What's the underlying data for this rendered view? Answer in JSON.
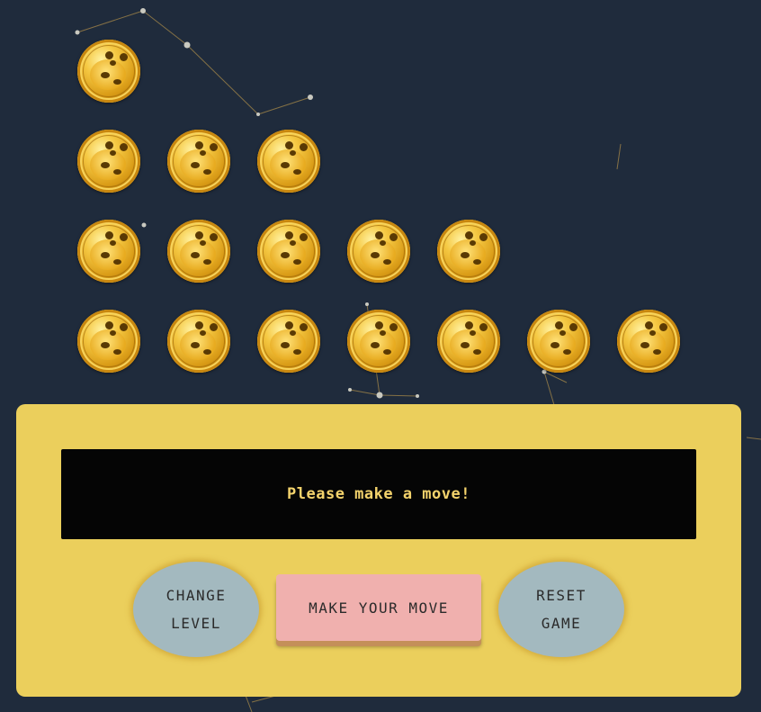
{
  "board": {
    "rows": [
      {
        "row": 1,
        "coins": 1
      },
      {
        "row": 2,
        "coins": 3
      },
      {
        "row": 3,
        "coins": 5
      },
      {
        "row": 4,
        "coins": 7
      }
    ],
    "coin_icon": "panda-gold-coin-icon"
  },
  "status": {
    "message": "Please make a move!"
  },
  "controls": {
    "change_level_line1": "CHANGE",
    "change_level_line2": "LEVEL",
    "make_move_label": "MAKE YOUR MOVE",
    "reset_game_line1": "RESET",
    "reset_game_line2": "GAME"
  },
  "colors": {
    "background": "#1f2b3c",
    "panel": "#ebcf5c",
    "screen": "#050505",
    "message_text": "#f4d36c",
    "round_button": "#a3b9bf",
    "primary_button": "#f0b0ae"
  }
}
